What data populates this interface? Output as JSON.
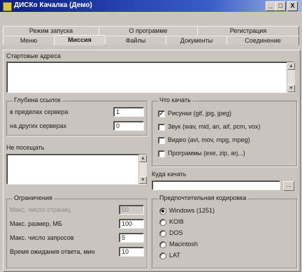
{
  "window": {
    "title": "ДИСКо Качалка (Демо)",
    "minimize": "_",
    "maximize": "□",
    "close": "X"
  },
  "tabs_back": [
    "Режим запуска",
    "О программе",
    "Регистрация"
  ],
  "tabs_front": [
    "Меню",
    "Миссия",
    "Файлы",
    "Документы",
    "Соединение"
  ],
  "active_tab": "Миссия",
  "start_addresses": {
    "label": "Стартовые адреса",
    "value": ""
  },
  "link_depth": {
    "label": "Глубина ссылок",
    "within_server_label": "в пределах сервера",
    "within_server_value": "1",
    "other_servers_label": "на других серверах",
    "other_servers_value": "0"
  },
  "do_not_visit": {
    "label": "Не посещать",
    "value": ""
  },
  "what_to_download": {
    "label": "Что качать",
    "items": [
      {
        "label": "Рисунки (gif, jpg, jpeg)",
        "checked": true
      },
      {
        "label": "Звук (wav, mid, an, aif, pcm, vox)",
        "checked": false
      },
      {
        "label": "Видео (avi, mov, mpg, mpeg)",
        "checked": false
      },
      {
        "label": "Программы (exe, zip, arj...)",
        "checked": false
      }
    ],
    "check_mark": "✓"
  },
  "download_to": {
    "label": "Куда качать",
    "value": "",
    "browse": "..."
  },
  "limits": {
    "label": "Ограничения",
    "max_pages_label": "Макс. число страниц",
    "max_pages_value": "50",
    "max_size_label": "Макс. размер, МБ",
    "max_size_value": "100",
    "max_requests_label": "Макс. число запросов",
    "max_requests_value": "5",
    "timeout_label": "Время ожидания ответа, мин",
    "timeout_value": "10"
  },
  "encoding": {
    "label": "Предпочтительная кодировка",
    "options": [
      "Windows (1251)",
      "KOI8",
      "DOS",
      "Macintosh",
      "LAT"
    ],
    "selected": "Windows (1251)"
  },
  "colors": {
    "title_bar_start": "#0a1e86",
    "title_bar_end": "#a6b9e6",
    "face": "#c9c4bd"
  }
}
